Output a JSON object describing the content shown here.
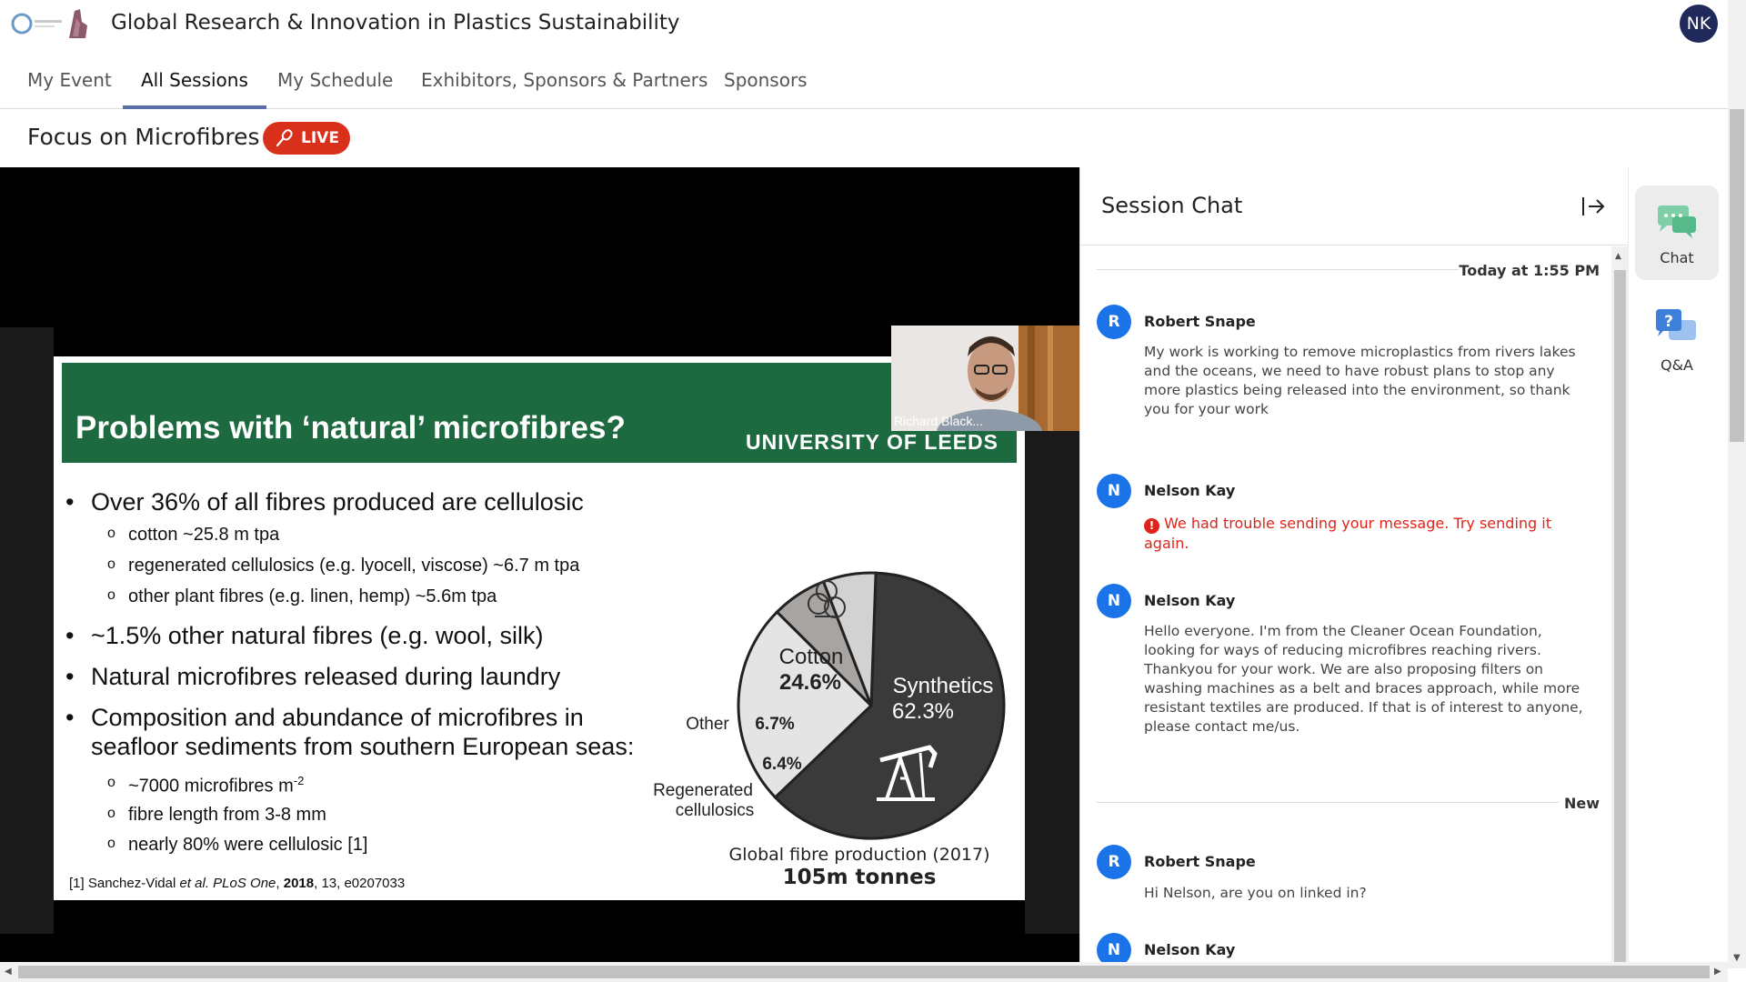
{
  "header": {
    "event_title": "Global Research & Innovation in Plastics Sustainability",
    "user_initials": "NK"
  },
  "nav": {
    "tabs": [
      {
        "label": "My Event",
        "active": false
      },
      {
        "label": "All Sessions",
        "active": true
      },
      {
        "label": "My Schedule",
        "active": false
      },
      {
        "label": "Exhibitors, Sponsors & Partners",
        "active": false
      },
      {
        "label": "Sponsors",
        "active": false
      }
    ]
  },
  "session": {
    "title": "Focus on Microfibres",
    "live_label": "LIVE"
  },
  "slide": {
    "title": "Problems with ‘natural’ microfibres?",
    "institution": "UNIVERSITY OF LEEDS",
    "bullets": {
      "b1": "Over 36% of all fibres produced are cellulosic",
      "b1a": "cotton ~25.8 m tpa",
      "b1b": "regenerated cellulosics (e.g. lyocell, viscose) ~6.7 m tpa",
      "b1c": "other plant fibres (e.g. linen, hemp) ~5.6m tpa",
      "b2": "~1.5% other natural fibres (e.g. wool, silk)",
      "b3": "Natural microfibres released during laundry",
      "b4a": "Composition and abundance of microfibres in",
      "b4b": "seafloor sediments from southern European seas:",
      "b4i": "~7000 microfibres m",
      "b4i_sup": "-2",
      "b4ii": "fibre length from 3-8 mm",
      "b4iii": "nearly 80% were cellulosic [1]"
    },
    "reference": {
      "prefix": "[1] Sanchez-Vidal ",
      "etal": "et al.",
      "journal": " PLoS One",
      "year": "2018",
      "rest": ", 13, e0207033"
    },
    "chart_caption": "Global fibre production (2017)",
    "chart_total": "105m tonnes",
    "presenter_name": "Richard Black..."
  },
  "chart_data": {
    "type": "pie",
    "title": "Global fibre production (2017)",
    "subtitle": "105m tonnes",
    "slices": [
      {
        "label": "Synthetics",
        "value": 62.3,
        "value_label": "62.3%",
        "color": "#3a3a3a"
      },
      {
        "label": "Cotton",
        "value": 24.6,
        "value_label": "24.6%",
        "color": "#e4e4e4"
      },
      {
        "label": "Other",
        "value": 6.7,
        "value_label": "6.7%",
        "color": "#a8a4a2"
      },
      {
        "label": "Regenerated cellulosics",
        "value": 6.4,
        "value_label": "6.4%",
        "color": "#d2d2d2"
      }
    ]
  },
  "chat": {
    "title": "Session Chat",
    "date_separator": "Today at 1:55 PM",
    "new_separator": "New",
    "messages": [
      {
        "initial": "R",
        "name": "Robert Snape",
        "text": "My work is working to remove microplastics from rivers lakes and the oceans, we need to have robust plans to stop any more plastics being released into the environment, so thank you for your work"
      },
      {
        "initial": "N",
        "name": "Nelson Kay",
        "error": "We had trouble sending your message. Try sending it again."
      },
      {
        "initial": "N",
        "name": "Nelson Kay",
        "text": "Hello everyone. I'm from the Cleaner Ocean Foundation, looking for ways of reducing microfibres reaching rivers. Thankyou for your work. We are also proposing filters on washing machines as a belt and braces approach, while more resistant textiles are produced. If that is of interest to anyone, please contact me/us."
      },
      {
        "initial": "R",
        "name": "Robert Snape",
        "text": "Hi Nelson, are you on linked in?"
      },
      {
        "initial": "N",
        "name": "Nelson Kay",
        "text": ""
      }
    ]
  },
  "rail": {
    "chat_label": "Chat",
    "qa_label": "Q&A"
  }
}
